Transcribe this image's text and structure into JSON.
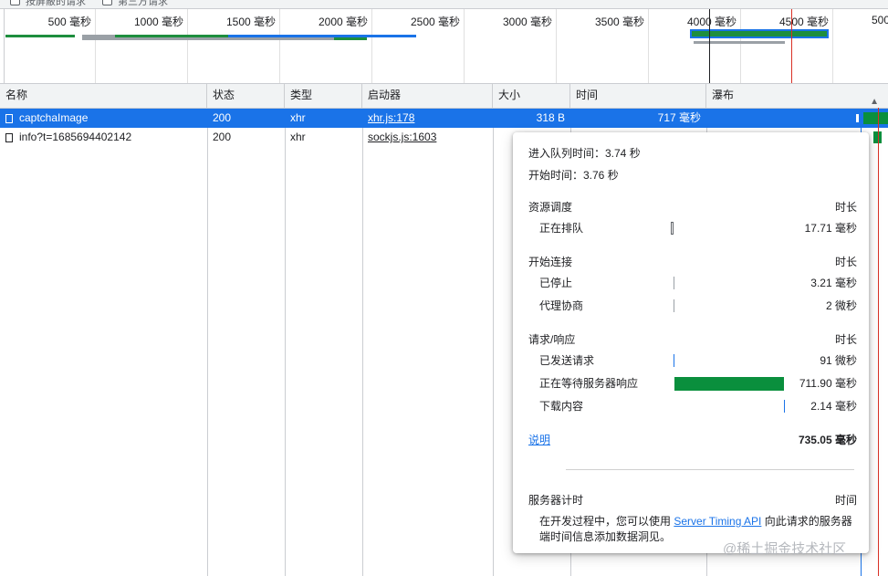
{
  "top_strip": {
    "checkbox1_label": "按屏蔽的请求",
    "checkbox2_label": "第三方请求"
  },
  "overview": {
    "ticks": [
      "500 毫秒",
      "1000 毫秒",
      "1500 毫秒",
      "2000 毫秒",
      "2500 毫秒",
      "3000 毫秒",
      "3500 毫秒",
      "4000 毫秒",
      "4500 毫秒",
      "500"
    ]
  },
  "columns": {
    "name": "名称",
    "status": "状态",
    "type": "类型",
    "initiator": "启动器",
    "size": "大小",
    "time": "时间",
    "waterfall": "瀑布"
  },
  "rows": [
    {
      "name": "captchaImage",
      "status": "200",
      "type": "xhr",
      "initiator": "xhr.js:178",
      "size": "318 B",
      "time": "717 毫秒"
    },
    {
      "name": "info?t=1685694402142",
      "status": "200",
      "type": "xhr",
      "initiator": "sockjs.js:1603",
      "size": "",
      "time": ""
    }
  ],
  "popover": {
    "queued_at": "进入队列时间：3.74 秒",
    "started_at": "开始时间：3.76 秒",
    "scheduling": {
      "title": "资源调度",
      "duration_label": "时长",
      "rows": [
        {
          "label": "正在排队",
          "value": "17.71 毫秒"
        }
      ]
    },
    "connection": {
      "title": "开始连接",
      "duration_label": "时长",
      "rows": [
        {
          "label": "已停止",
          "value": "3.21 毫秒"
        },
        {
          "label": "代理协商",
          "value": "2 微秒"
        }
      ]
    },
    "request": {
      "title": "请求/响应",
      "duration_label": "时长",
      "rows": [
        {
          "label": "已发送请求",
          "value": "91 微秒"
        },
        {
          "label": "正在等待服务器响应",
          "value": "711.90 毫秒"
        },
        {
          "label": "下载内容",
          "value": "2.14 毫秒"
        }
      ]
    },
    "explanation_link": "说明",
    "total": "735.05 毫秒",
    "server_timing": {
      "title": "服务器计时",
      "duration_label": "时间",
      "text_before": "在开发过程中，您可以使用 ",
      "link": "Server Timing API",
      "text_after": " 向此请求的服务器端时间信息添加数据洞见。"
    }
  },
  "watermark": "@稀土掘金技术社区",
  "colors": {
    "selected_row": "#1a73e8",
    "waiting_bar": "#0a8f3d",
    "cursor_red": "#d93025"
  }
}
